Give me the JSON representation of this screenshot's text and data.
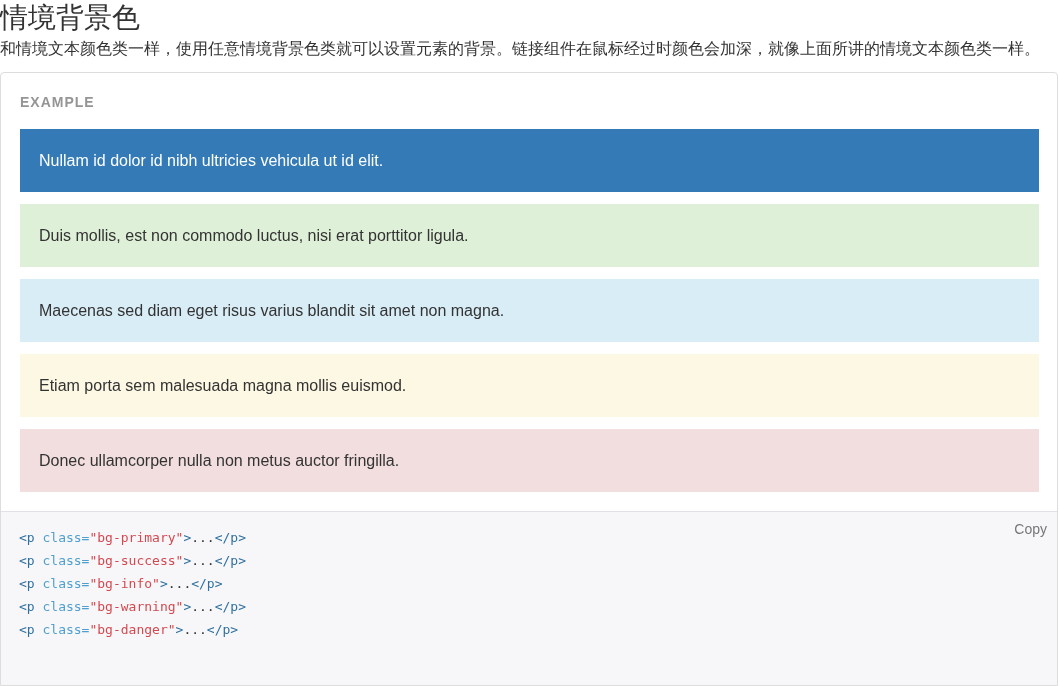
{
  "title": "情境背景色",
  "description": "和情境文本颜色类一样，使用任意情境背景色类就可以设置元素的背景。链接组件在鼠标经过时颜色会加深，就像上面所讲的情境文本颜色类一样。",
  "example": {
    "label": "EXAMPLE",
    "blocks": [
      {
        "text": "Nullam id dolor id nibh ultricies vehicula ut id elit.",
        "color": "#337ab7"
      },
      {
        "text": "Duis mollis, est non commodo luctus, nisi erat porttitor ligula.",
        "color": "#dff0d8"
      },
      {
        "text": "Maecenas sed diam eget risus varius blandit sit amet non magna.",
        "color": "#d9edf7"
      },
      {
        "text": "Etiam porta sem malesuada magna mollis euismod.",
        "color": "#fcf8e3"
      },
      {
        "text": "Donec ullamcorper nulla non metus auctor fringilla.",
        "color": "#f2dede"
      }
    ]
  },
  "code": {
    "copy_button": "Copy",
    "lines": [
      [
        {
          "kind": "tag",
          "text": "<p"
        },
        {
          "kind": "attr",
          "text": " class="
        },
        {
          "kind": "string",
          "text": "\"bg-primary\""
        },
        {
          "kind": "tag",
          "text": ">"
        },
        {
          "kind": "plain",
          "text": "..."
        },
        {
          "kind": "tag",
          "text": "</p>"
        }
      ],
      [
        {
          "kind": "tag",
          "text": "<p"
        },
        {
          "kind": "attr",
          "text": " class="
        },
        {
          "kind": "string",
          "text": "\"bg-success\""
        },
        {
          "kind": "tag",
          "text": ">"
        },
        {
          "kind": "plain",
          "text": "..."
        },
        {
          "kind": "tag",
          "text": "</p>"
        }
      ],
      [
        {
          "kind": "tag",
          "text": "<p"
        },
        {
          "kind": "attr",
          "text": " class="
        },
        {
          "kind": "string",
          "text": "\"bg-info\""
        },
        {
          "kind": "tag",
          "text": ">"
        },
        {
          "kind": "plain",
          "text": "..."
        },
        {
          "kind": "tag",
          "text": "</p>"
        }
      ],
      [
        {
          "kind": "tag",
          "text": "<p"
        },
        {
          "kind": "attr",
          "text": " class="
        },
        {
          "kind": "string",
          "text": "\"bg-warning\""
        },
        {
          "kind": "tag",
          "text": ">"
        },
        {
          "kind": "plain",
          "text": "..."
        },
        {
          "kind": "tag",
          "text": "</p>"
        }
      ],
      [
        {
          "kind": "tag",
          "text": "<p"
        },
        {
          "kind": "attr",
          "text": " class="
        },
        {
          "kind": "string",
          "text": "\"bg-danger\""
        },
        {
          "kind": "tag",
          "text": ">"
        },
        {
          "kind": "plain",
          "text": "..."
        },
        {
          "kind": "tag",
          "text": "</p>"
        }
      ]
    ]
  }
}
